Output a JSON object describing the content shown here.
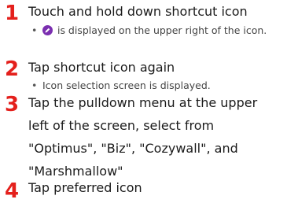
{
  "steps": [
    {
      "number": "1",
      "title": "Touch and hold down shortcut icon",
      "note_before_icon": "",
      "note_icon": "edit-badge-icon",
      "note_after_icon": " is displayed on the upper right of the icon."
    },
    {
      "number": "2",
      "title": "Tap shortcut icon again",
      "note": "Icon selection screen is displayed."
    },
    {
      "number": "3",
      "title": "Tap the pulldown menu at the upper left of the screen, select from \"Optimus\", \"Biz\", \"Cozywall\", and \"Marshmallow\""
    },
    {
      "number": "4",
      "title": "Tap preferred icon"
    }
  ],
  "colors": {
    "step_number": "#e4201c",
    "badge": "#7b2fb0"
  }
}
